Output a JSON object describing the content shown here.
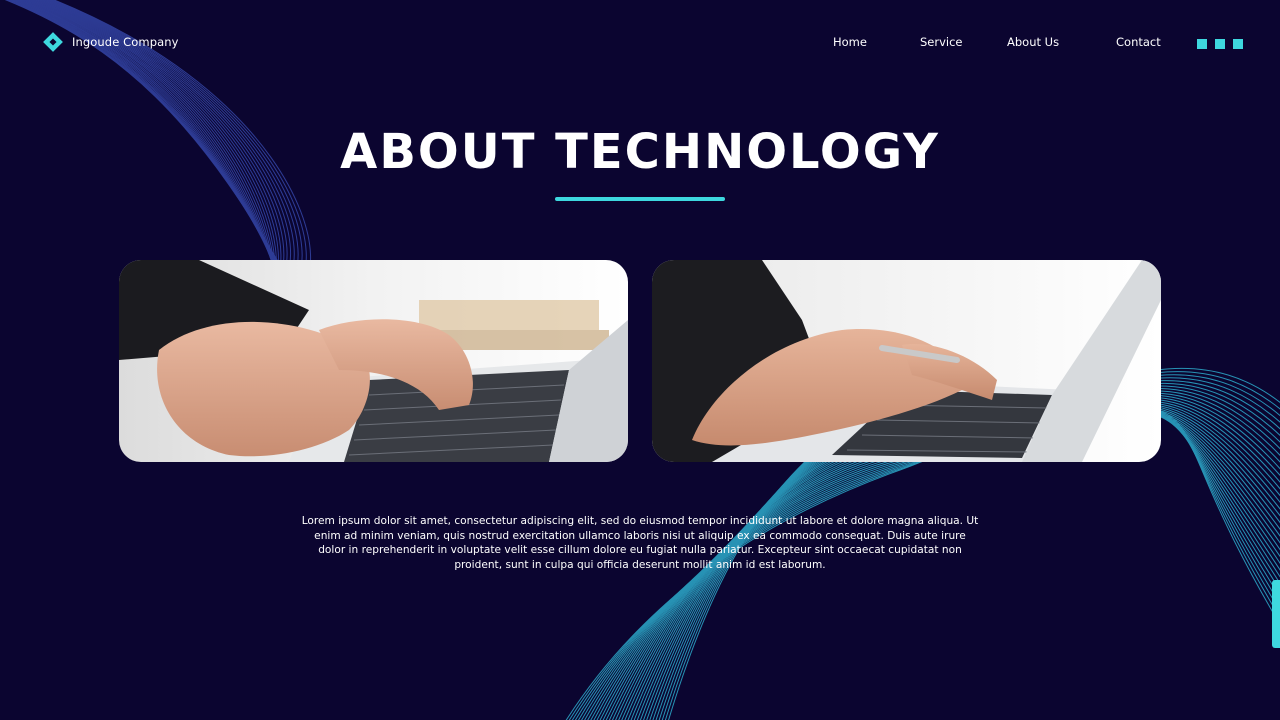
{
  "brand": {
    "name": "Ingoude Company"
  },
  "nav": {
    "items": [
      {
        "label": "Home"
      },
      {
        "label": "Service"
      },
      {
        "label": "About Us"
      },
      {
        "label": "Contact"
      }
    ]
  },
  "hero": {
    "title": "ABOUT TECHNOLOGY",
    "body": "Lorem ipsum dolor sit amet, consectetur adipiscing elit, sed do eiusmod tempor incididunt ut labore et dolore magna aliqua. Ut enim ad minim veniam, quis nostrud exercitation ullamco laboris nisi ut aliquip ex ea commodo consequat. Duis aute irure dolor in reprehenderit in voluptate velit esse cillum dolore eu fugiat nulla pariatur. Excepteur sint occaecat cupidatat non proident, sunt in culpa qui officia deserunt mollit anim id est laborum."
  },
  "images": [
    {
      "icon": "laptop-typing-photo"
    },
    {
      "icon": "laptop-pen-photo"
    }
  ],
  "colors": {
    "background": "#0b0530",
    "accent": "#3ed8df",
    "line_blue": "#3a4fb8",
    "line_cyan": "#2fb6d6"
  }
}
